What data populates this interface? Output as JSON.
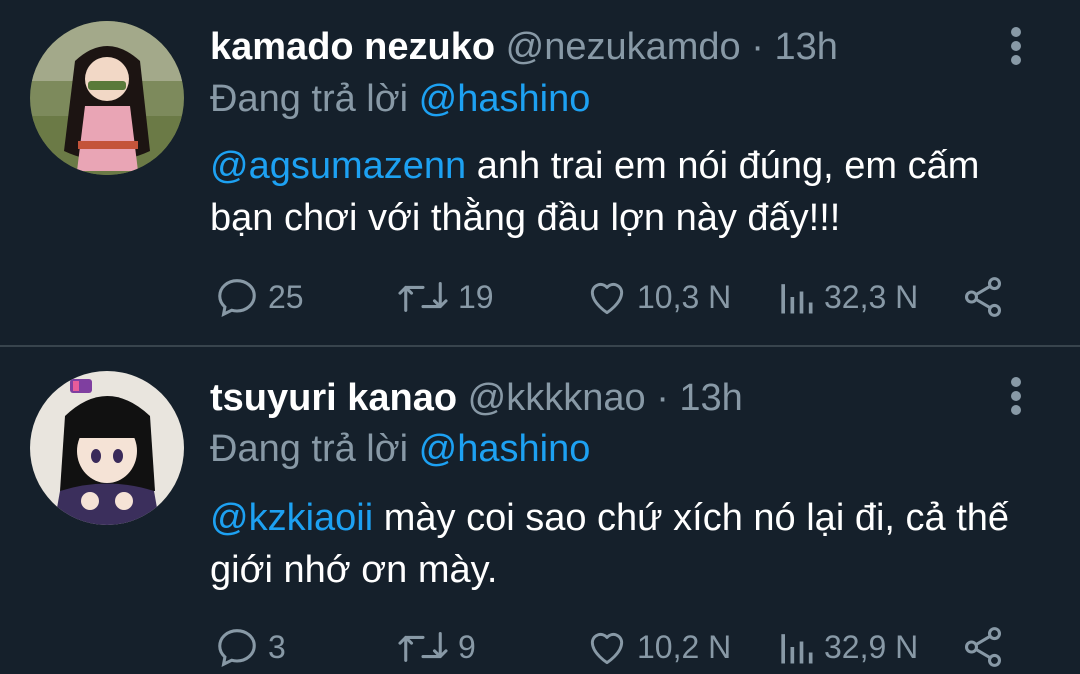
{
  "tweets": [
    {
      "display_name": "kamado nezuko",
      "handle": "@nezukamdo",
      "separator": "·",
      "time": "13h",
      "reply_prefix": "Đang trả lời",
      "reply_to": "@hashino",
      "mention": "@agsumazenn",
      "text": " anh trai em nói đúng, em cấm bạn chơi với thằng đầu lợn này đấy!!!",
      "replies": "25",
      "retweets": "19",
      "likes": "10,3 N",
      "views": "32,3 N",
      "avatar_icon": "nezuko-avatar"
    },
    {
      "display_name": "tsuyuri kanao",
      "handle": "@kkkknao",
      "separator": "·",
      "time": "13h",
      "reply_prefix": "Đang trả lời",
      "reply_to": "@hashino",
      "mention": "@kzkiaoii",
      "text": " mày coi sao chứ xích nó lại đi, cả thế giới nhớ ơn mày.",
      "replies": "3",
      "retweets": "9",
      "likes": "10,2 N",
      "views": "32,9 N",
      "avatar_icon": "kanao-avatar"
    }
  ],
  "colors": {
    "background": "#15202b",
    "text": "#ffffff",
    "secondary": "#8899a6",
    "link": "#1da1f2",
    "divider": "#38444d"
  },
  "icons": [
    "reply-icon",
    "retweet-icon",
    "like-icon",
    "views-icon",
    "share-icon",
    "more-icon"
  ]
}
